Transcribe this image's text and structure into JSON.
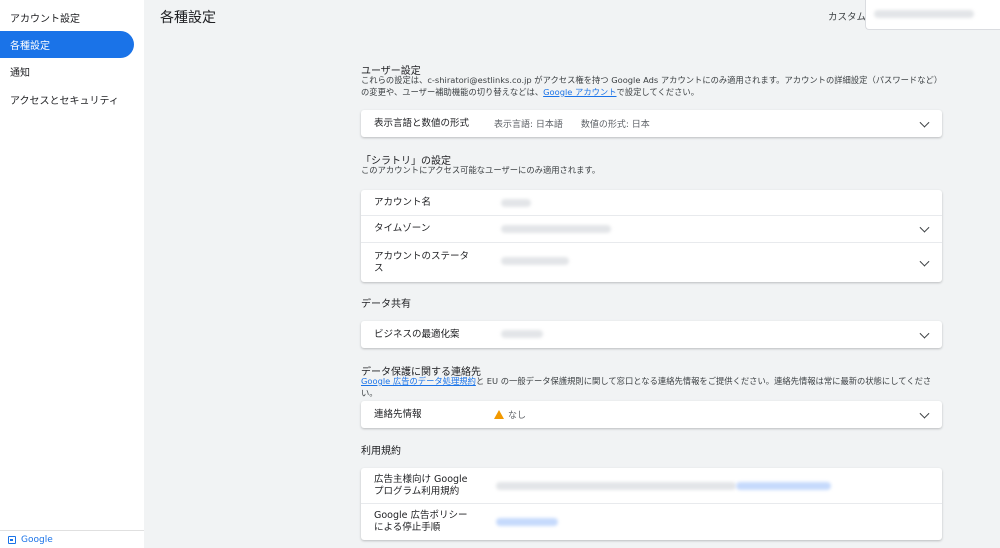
{
  "sidebar": {
    "items": [
      {
        "label": "アカウント設定"
      },
      {
        "label": "各種設定"
      },
      {
        "label": "通知"
      },
      {
        "label": "アクセスとセキュリティ"
      }
    ],
    "footer_label": "Google"
  },
  "header": {
    "title": "各種設定",
    "custom_label": "カスタム"
  },
  "user_settings": {
    "title": "ユーザー設定",
    "desc_prefix": "これらの設定は、c-shiratori@estlinks.co.jp がアクセス権を持つ Google Ads アカウントにのみ適用されます。アカウントの詳細設定（パスワードなど）の変更や、ユーザー補助機能の切り替えなどは、",
    "desc_link": "Google アカウント",
    "desc_suffix": "で設定してください。",
    "row_label": "表示言語と数値の形式",
    "display_lang": "表示言語: 日本語",
    "number_format": "数値の形式: 日本"
  },
  "account_settings": {
    "title": "「シラトリ」の設定",
    "desc": "このアカウントにアクセス可能なユーザーにのみ適用されます。",
    "rows": [
      {
        "label": "アカウント名"
      },
      {
        "label": "タイムゾーン"
      },
      {
        "label": "アカウントのステータス"
      }
    ]
  },
  "data_sharing": {
    "title": "データ共有",
    "row_label": "ビジネスの最適化案"
  },
  "data_protection": {
    "title": "データ保護に関する連絡先",
    "desc_link": "Google 広告のデータ処理規約",
    "desc_suffix": "と EU の一般データ保護規則に関して窓口となる連絡先情報をご提供ください。連絡先情報は常に最新の状態にしてください。",
    "row_label": "連絡先情報",
    "row_value": "なし"
  },
  "terms": {
    "title": "利用規約",
    "rows": [
      {
        "label": "広告主様向け Google プログラム利用規約"
      },
      {
        "label": "Google 広告ポリシーによる停止手順"
      }
    ]
  },
  "icons": {
    "chevron": "chevron-down-icon",
    "warning": "warning-icon",
    "footer": "google-icon"
  },
  "colors": {
    "accent": "#1a73e8",
    "background": "#f1f3f4",
    "warning": "#f29900"
  }
}
